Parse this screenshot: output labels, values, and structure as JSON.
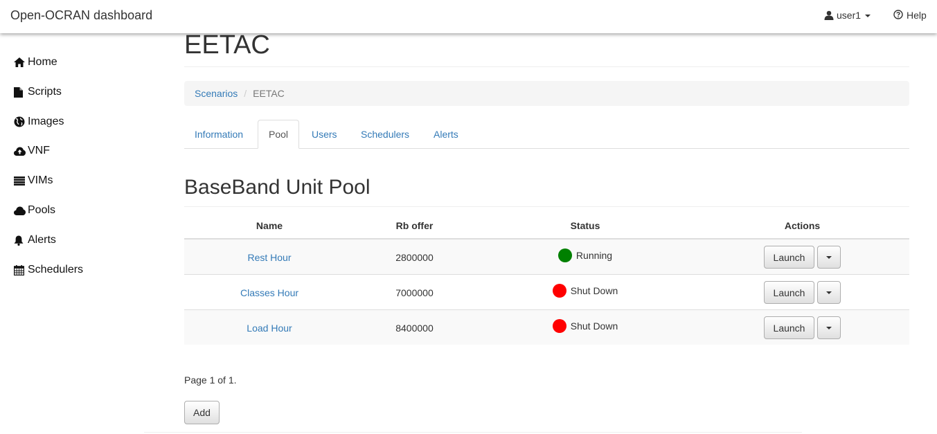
{
  "navbar": {
    "brand": "Open-OCRAN dashboard",
    "user_label": "user1",
    "help_label": "Help"
  },
  "sidebar": {
    "items": [
      {
        "label": "Home",
        "icon": "home-icon"
      },
      {
        "label": "Scripts",
        "icon": "file-icon"
      },
      {
        "label": "Images",
        "icon": "globe-icon"
      },
      {
        "label": "VNF",
        "icon": "cloud-upload-icon"
      },
      {
        "label": "VIMs",
        "icon": "list-icon"
      },
      {
        "label": "Pools",
        "icon": "cloud-icon"
      },
      {
        "label": "Alerts",
        "icon": "bell-icon"
      },
      {
        "label": "Schedulers",
        "icon": "calendar-icon"
      }
    ]
  },
  "page": {
    "title": "EETAC",
    "breadcrumb": {
      "parent": "Scenarios",
      "current": "EETAC"
    },
    "tabs": [
      {
        "label": "Information",
        "active": false
      },
      {
        "label": "Pool",
        "active": true
      },
      {
        "label": "Users",
        "active": false
      },
      {
        "label": "Schedulers",
        "active": false
      },
      {
        "label": "Alerts",
        "active": false
      }
    ],
    "section_title": "BaseBand Unit Pool"
  },
  "table": {
    "headers": {
      "name": "Name",
      "rb_offer": "Rb offer",
      "status": "Status",
      "actions": "Actions"
    },
    "rows": [
      {
        "name": "Rest Hour",
        "rb_offer": "2800000",
        "status": "Running",
        "status_color": "#008000",
        "action": "Launch"
      },
      {
        "name": "Classes Hour",
        "rb_offer": "7000000",
        "status": "Shut Down",
        "status_color": "#ff0000",
        "action": "Launch"
      },
      {
        "name": "Load Hour",
        "rb_offer": "8400000",
        "status": "Shut Down",
        "status_color": "#ff0000",
        "action": "Launch"
      }
    ]
  },
  "pagination": {
    "text": "Page 1 of 1."
  },
  "buttons": {
    "add": "Add"
  },
  "colors": {
    "link": "#337ab7",
    "running": "#008000",
    "shutdown": "#ff0000"
  }
}
